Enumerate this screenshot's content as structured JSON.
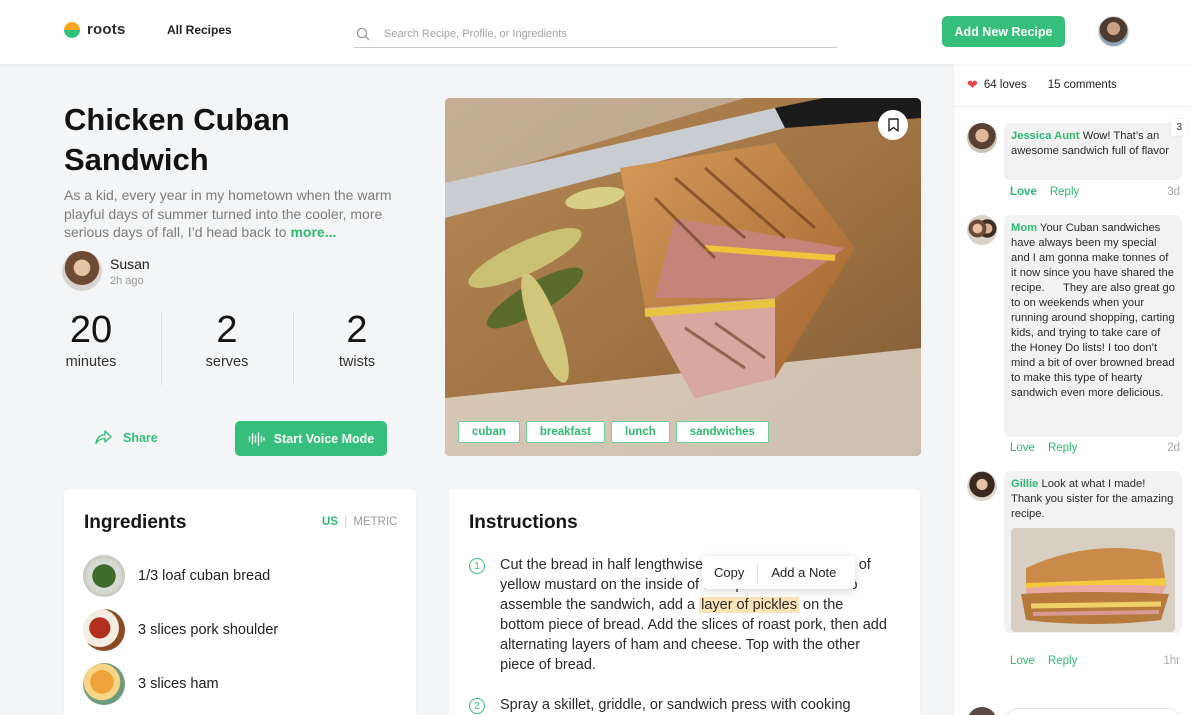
{
  "header": {
    "brand": "roots",
    "nav_all_recipes": "All Recipes",
    "search_placeholder": "Search Recipe, Profile, or Ingredients",
    "add_button": "Add New Recipe"
  },
  "recipe": {
    "title": "Chicken Cuban Sandwich",
    "description": "As a kid, every year in my hometown when the warm playful days of summer turned into the cooler, more serious days of fall, I’d head back to",
    "more_link": "more...",
    "author": {
      "name": "Susan",
      "time": "2h ago"
    },
    "stats": [
      {
        "value": "20",
        "label": "minutes"
      },
      {
        "value": "2",
        "label": "serves"
      },
      {
        "value": "2",
        "label": "twists"
      }
    ],
    "share_label": "Share",
    "voice_label": "Start Voice Mode",
    "tags": [
      "cuban",
      "breakfast",
      "lunch",
      "sandwiches"
    ]
  },
  "ingredients": {
    "title": "Ingredients",
    "unit_us": "US",
    "unit_sep": "|",
    "unit_metric": "METRIC",
    "items": [
      {
        "text": "1/3 loaf cuban bread"
      },
      {
        "text": "3 slices pork shoulder"
      },
      {
        "text": "3 slices ham"
      }
    ]
  },
  "instructions": {
    "title": "Instructions",
    "steps": [
      {
        "num": "1",
        "before": "Cut the bread in half lengthwise and spread a thin layer of yellow mustard on the inside of both pieces of bread. To assemble the sandwich, add a ",
        "highlight": "layer of pickles",
        "after": " on the bottom piece of bread. Add the slices of roast pork, then add alternating layers of ham and cheese. Top with the other piece of bread."
      },
      {
        "num": "2",
        "text": "Spray a skillet, griddle, or sandwich press with cooking"
      }
    ],
    "popup": {
      "copy": "Copy",
      "note": "Add a Note"
    }
  },
  "sidebar": {
    "loves": "64 loves",
    "comments": "15 comments",
    "comment_list": [
      {
        "author": "Jessica Aunt",
        "text": "Wow! That’s an awesome sandwich full of flavor",
        "badge": "3",
        "love": "Love",
        "reply": "Reply",
        "time": "3d"
      },
      {
        "author": "Mom",
        "text": "Your Cuban sandwiches have always been my special and I am gonna make tonnes of it now since you have shared the recipe.      They are also great go to on weekends when your running around shopping, carting kids, and trying to take care of the Honey Do lists! I too don’t mind a bit of over browned bread to make this type of hearty sandwich even more delicious.",
        "love": "Love",
        "reply": "Reply",
        "time": "2d"
      },
      {
        "author": "Gillie",
        "text": "Look at what I made! Thank you sister for the amazing recipe.",
        "love": "Love",
        "reply": "Reply",
        "time": "1hr"
      }
    ]
  },
  "colors": {
    "accent": "#35bf7a",
    "heart": "#e84545",
    "highlight": "#fde3b8"
  }
}
